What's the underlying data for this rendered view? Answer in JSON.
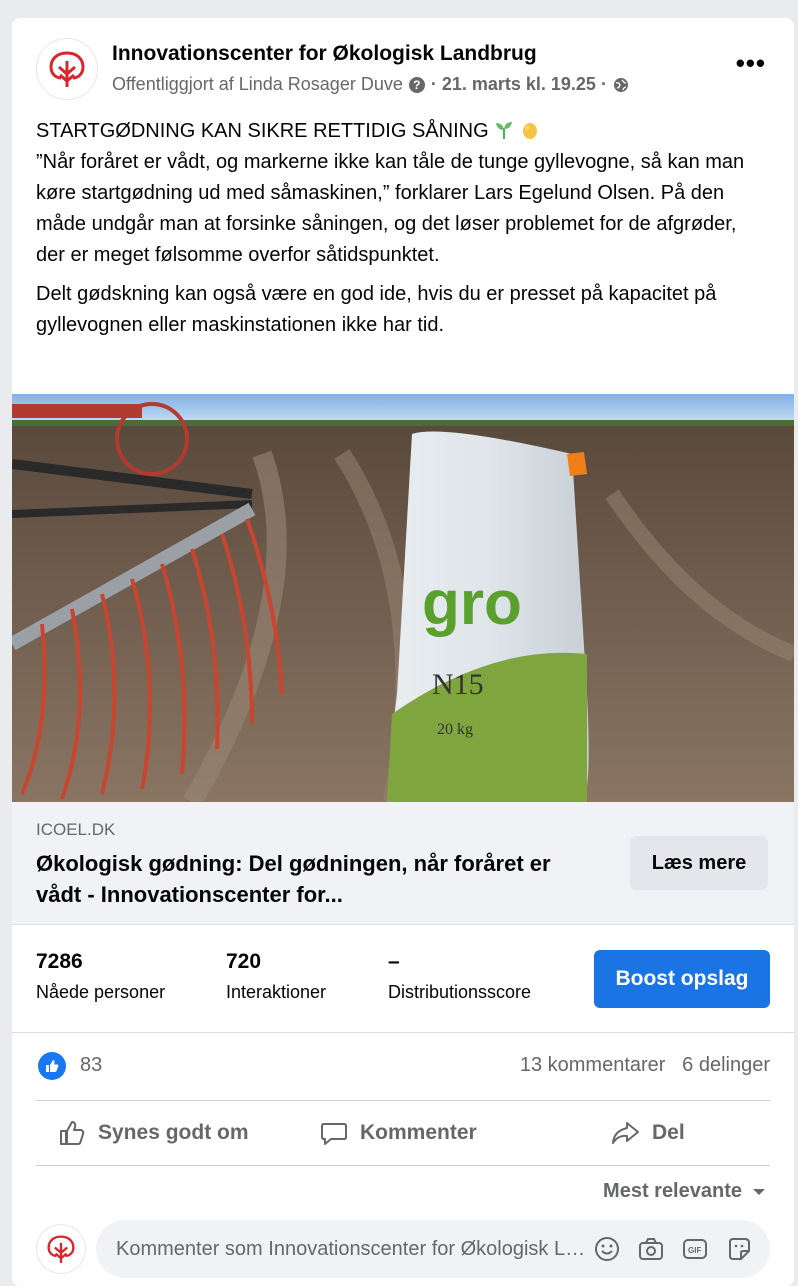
{
  "post": {
    "page_name": "Innovationscenter for Økologisk Landbrug",
    "published_by": "Offentliggjort af Linda Rosager Duve",
    "date": "· 21. marts kl. 19.25 ·",
    "more_icon": "more-options-icon",
    "heading": "STARTGØDNING KAN SIKRE RETTIDIG SÅNING",
    "paragraph1": "”Når foråret er vådt, og markerne ikke kan tåle de tunge gyllevogne, så kan man køre startgødning ud med såmaskinen,” forklarer Lars Egelund Olsen. På den måde undgår man at forsinke såningen, og det løser problemet for de afgrøder, der er meget følsomme overfor såtidspunktet.",
    "paragraph2": "Delt gødskning kan også være en god ide, hvis du er presset på kapacitet på gyllevognen eller maskinstationen ikke har tid.",
    "photo_bag_brand": "gro",
    "photo_bag_code": "N15",
    "photo_bag_weight": "20 kg"
  },
  "link": {
    "domain": "ICOEL.DK",
    "title": "Økologisk gødning: Del gødningen, når foråret er vådt - Innovationscenter for...",
    "button": "Læs mere"
  },
  "insights": {
    "reached_value": "7286",
    "reached_label": "Nåede personer",
    "interactions_value": "720",
    "interactions_label": "Interaktioner",
    "distribution_value": "–",
    "distribution_label": "Distributionsscore",
    "boost_button": "Boost opslag"
  },
  "reactions": {
    "likes": "83",
    "comments": "13 kommentarer",
    "shares": "6 delinger"
  },
  "actions": {
    "like": "Synes godt om",
    "comment": "Kommenter",
    "share": "Del"
  },
  "comments": {
    "sort_label": "Mest relevante",
    "placeholder": "Kommenter som Innovationscenter for Økologisk Landbrug"
  },
  "colors": {
    "brand_blue": "#1b74e4",
    "logo_red": "#d9252b"
  }
}
